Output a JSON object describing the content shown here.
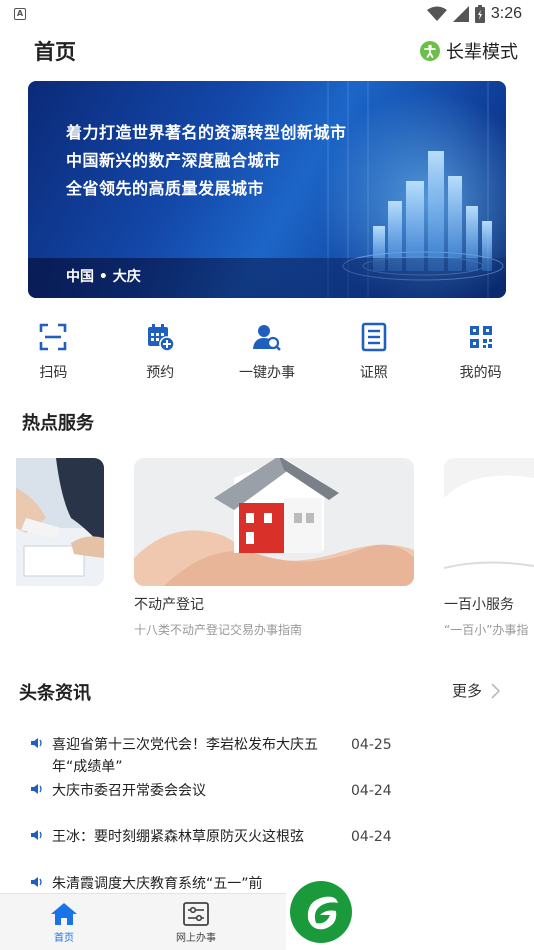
{
  "status_bar": {
    "time": "3:26",
    "app_badge": "A"
  },
  "header": {
    "title": "首页",
    "elder_mode_label": "长辈模式"
  },
  "banner": {
    "lines": [
      "着力打造世界著名的资源转型创新城市",
      "中国新兴的数产深度融合城市",
      "全省领先的高质量发展城市"
    ],
    "footer": "中国 • 大庆"
  },
  "quick_actions": [
    {
      "label": "扫码",
      "icon": "scan-icon"
    },
    {
      "label": "预约",
      "icon": "calendar-add-icon"
    },
    {
      "label": "一键办事",
      "icon": "user-search-icon"
    },
    {
      "label": "证照",
      "icon": "document-list-icon"
    },
    {
      "label": "我的码",
      "icon": "qr-code-icon"
    }
  ],
  "hot_services": {
    "title": "热点服务",
    "items": [
      {
        "name": "",
        "desc": ""
      },
      {
        "name": "不动产登记",
        "desc": "十八类不动产登记交易办事指南"
      },
      {
        "name": "一百小服务",
        "desc": "“一百小”办事指"
      }
    ]
  },
  "news": {
    "title": "头条资讯",
    "more_label": "更多",
    "items": [
      {
        "title": "喜迎省第十三次党代会！李岩松发布大庆五年“成绩单”",
        "date": "04-25"
      },
      {
        "title": "大庆市委召开常委会会议",
        "date": "04-24"
      },
      {
        "title": "王冰：要时刻绷紧森林草原防灭火这根弦",
        "date": "04-24"
      },
      {
        "title": "朱清霞调度大庆教育系统“五一”前",
        "date": ""
      }
    ]
  },
  "bottom_nav": {
    "tabs": [
      {
        "label": "首页",
        "icon": "home-icon",
        "active": true
      },
      {
        "label": "网上办事",
        "icon": "settings-sliders-icon",
        "active": false
      }
    ]
  },
  "colors": {
    "accent": "#1a73e8",
    "primary_icon": "#1f5fbf",
    "elder_green": "#6cc04a",
    "fab_green": "#1a9a3a"
  }
}
